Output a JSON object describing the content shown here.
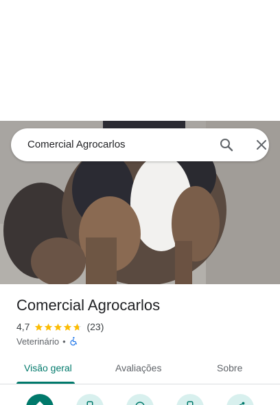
{
  "search": {
    "query": "Comercial Agrocarlos"
  },
  "place": {
    "title": "Comercial Agrocarlos",
    "rating": "4,7",
    "review_count": "(23)",
    "stars": 4.7,
    "category": "Veterinário",
    "separator": "•"
  },
  "tabs": [
    {
      "label": "Visão geral",
      "active": true
    },
    {
      "label": "Avaliações",
      "active": false
    },
    {
      "label": "Sobre",
      "active": false
    }
  ],
  "colors": {
    "accent": "#00796b",
    "star": "#fbbc04",
    "accessibility": "#1a73e8"
  },
  "icons": {
    "search": "search-icon",
    "close": "close-icon",
    "accessibility": "wheelchair-icon",
    "actions": [
      "directions-icon",
      "phone-icon",
      "save-icon",
      "phone-icon",
      "share-icon"
    ]
  }
}
